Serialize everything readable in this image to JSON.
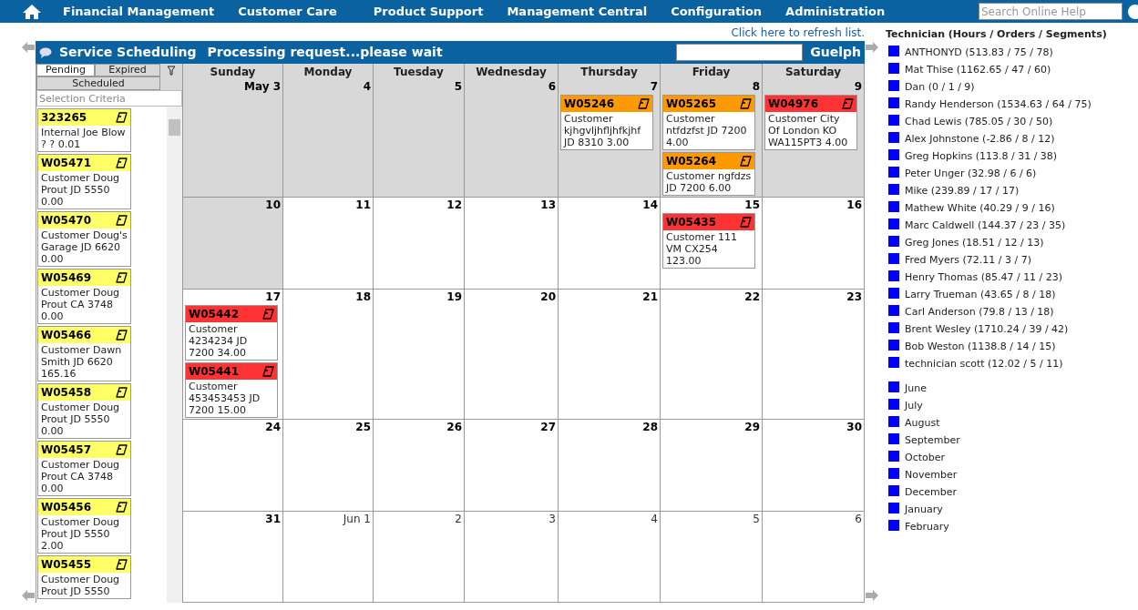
{
  "nav": {
    "items": [
      "Financial Management",
      "Customer Care",
      "Product Support",
      "Management Central",
      "Configuration",
      "Administration"
    ],
    "search_placeholder": "Search Online Help"
  },
  "refresh_link": "Click here to refresh list.",
  "panel": {
    "title": "Service Scheduling",
    "status": "Processing request...please wait",
    "location": "Guelph"
  },
  "sidebar": {
    "tabs": [
      {
        "label": "Pending",
        "selected": true
      },
      {
        "label": "Expired",
        "selected": false
      },
      {
        "label": "Scheduled",
        "selected": false
      }
    ],
    "filter_placeholder": "Selection Criteria",
    "orders": [
      {
        "id": "323265",
        "color": "#ffff66",
        "text": "Internal Joe Blow ? ? 0.01"
      },
      {
        "id": "W05471",
        "color": "#ffff66",
        "text": "Customer Doug Prout JD 5550 0.00"
      },
      {
        "id": "W05470",
        "color": "#ffff66",
        "text": "Customer Doug's Garage JD 6620 0.00"
      },
      {
        "id": "W05469",
        "color": "#ffff66",
        "text": "Customer Doug Prout CA 3748 0.00"
      },
      {
        "id": "W05466",
        "color": "#ffff66",
        "text": "Customer Dawn Smith JD 6620 165.16"
      },
      {
        "id": "W05458",
        "color": "#ffff66",
        "text": "Customer Doug Prout JD 5550 0.00"
      },
      {
        "id": "W05457",
        "color": "#ffff66",
        "text": "Customer Doug Prout CA 3748 0.00"
      },
      {
        "id": "W05456",
        "color": "#ffff66",
        "text": "Customer Doug Prout JD 5550 2.00"
      },
      {
        "id": "W05455",
        "color": "#ffff66",
        "text": "Customer Doug Prout JD 5550"
      }
    ]
  },
  "calendar": {
    "weekdays": [
      "Sunday",
      "Monday",
      "Tuesday",
      "Wednesday",
      "Thursday",
      "Friday",
      "Saturday"
    ],
    "weeks": [
      {
        "days": [
          {
            "date": "May 3",
            "shaded": true,
            "current_month": true
          },
          {
            "date": "4",
            "shaded": true,
            "current_month": true
          },
          {
            "date": "5",
            "shaded": true,
            "current_month": true
          },
          {
            "date": "6",
            "shaded": true,
            "current_month": true
          },
          {
            "date": "7",
            "shaded": true,
            "current_month": true,
            "orders": [
              {
                "id": "W05246",
                "color": "#ff9900",
                "text": "Customer kjhgvljhfljhfkjhf JD 8310 3.00"
              }
            ]
          },
          {
            "date": "8",
            "shaded": true,
            "current_month": true,
            "orders": [
              {
                "id": "W05265",
                "color": "#ff9900",
                "text": "Customer ntfdzfst JD 7200 4.00"
              },
              {
                "id": "W05264",
                "color": "#ff9900",
                "text": "Customer ngfdzs JD 7200 6.00"
              }
            ]
          },
          {
            "date": "9",
            "shaded": true,
            "current_month": true,
            "orders": [
              {
                "id": "W04976",
                "color": "#ff3333",
                "text": "Customer City Of London KO WA115PT3 4.00"
              }
            ]
          }
        ]
      },
      {
        "days": [
          {
            "date": "10",
            "shaded": true,
            "current_month": true
          },
          {
            "date": "11",
            "shaded": false,
            "current_month": true
          },
          {
            "date": "12",
            "shaded": false,
            "current_month": true
          },
          {
            "date": "13",
            "shaded": false,
            "current_month": true
          },
          {
            "date": "14",
            "shaded": false,
            "current_month": true
          },
          {
            "date": "15",
            "shaded": false,
            "current_month": true,
            "orders": [
              {
                "id": "W05435",
                "color": "#ff3333",
                "text": "Customer 111 VM CX254 123.00"
              }
            ]
          },
          {
            "date": "16",
            "shaded": false,
            "current_month": true
          }
        ]
      },
      {
        "days": [
          {
            "date": "17",
            "shaded": false,
            "current_month": true,
            "orders": [
              {
                "id": "W05442",
                "color": "#ff3333",
                "text": "Customer 4234234 JD 7200 34.00"
              },
              {
                "id": "W05441",
                "color": "#ff3333",
                "text": "Customer 453453453 JD 7200 15.00"
              }
            ]
          },
          {
            "date": "18",
            "shaded": false,
            "current_month": true
          },
          {
            "date": "19",
            "shaded": false,
            "current_month": true
          },
          {
            "date": "20",
            "shaded": false,
            "current_month": true
          },
          {
            "date": "21",
            "shaded": false,
            "current_month": true
          },
          {
            "date": "22",
            "shaded": false,
            "current_month": true
          },
          {
            "date": "23",
            "shaded": false,
            "current_month": true
          }
        ]
      },
      {
        "days": [
          {
            "date": "24",
            "shaded": false,
            "current_month": true
          },
          {
            "date": "25",
            "shaded": false,
            "current_month": true
          },
          {
            "date": "26",
            "shaded": false,
            "current_month": true
          },
          {
            "date": "27",
            "shaded": false,
            "current_month": true
          },
          {
            "date": "28",
            "shaded": false,
            "current_month": true
          },
          {
            "date": "29",
            "shaded": false,
            "current_month": true
          },
          {
            "date": "30",
            "shaded": false,
            "current_month": true
          }
        ]
      },
      {
        "days": [
          {
            "date": "31",
            "shaded": false,
            "current_month": true
          },
          {
            "date": "Jun 1",
            "shaded": false,
            "current_month": false
          },
          {
            "date": "2",
            "shaded": false,
            "current_month": false
          },
          {
            "date": "3",
            "shaded": false,
            "current_month": false
          },
          {
            "date": "4",
            "shaded": false,
            "current_month": false
          },
          {
            "date": "5",
            "shaded": false,
            "current_month": false
          },
          {
            "date": "6",
            "shaded": false,
            "current_month": false
          }
        ]
      }
    ]
  },
  "legend": {
    "title": "Technician (Hours / Orders / Segments)",
    "technicians": [
      "ANTHONYD (513.83 / 75 / 78)",
      "Mat Thise (1162.65 / 47 / 60)",
      "Dan (0 / 1 / 9)",
      "Randy Henderson (1534.63 / 64 / 75)",
      "Chad Lewis (785.05 / 30 / 50)",
      "Alex Johnstone (-2.86 / 8 / 12)",
      "Greg Hopkins (113.8 / 31 / 38)",
      "Peter Unger (32.98 / 6 / 6)",
      "Mike (239.89 / 17 / 17)",
      "Mathew White (40.29 / 9 / 16)",
      "Marc Caldwell (144.37 / 23 / 35)",
      "Greg Jones (18.51 / 12 / 13)",
      "Fred Myers (72.11 / 3 / 7)",
      "Henry Thomas (85.47 / 11 / 23)",
      "Larry Trueman (43.65 / 8 / 18)",
      "Carl Anderson (79.8 / 13 / 18)",
      "Brent Wesley (1710.24 / 39 / 42)",
      "Bob Weston (1138.8 / 14 / 15)",
      "technician scott (12.02 / 5 / 11)"
    ],
    "months": [
      "June",
      "July",
      "August",
      "September",
      "October",
      "November",
      "December",
      "January",
      "February"
    ]
  }
}
